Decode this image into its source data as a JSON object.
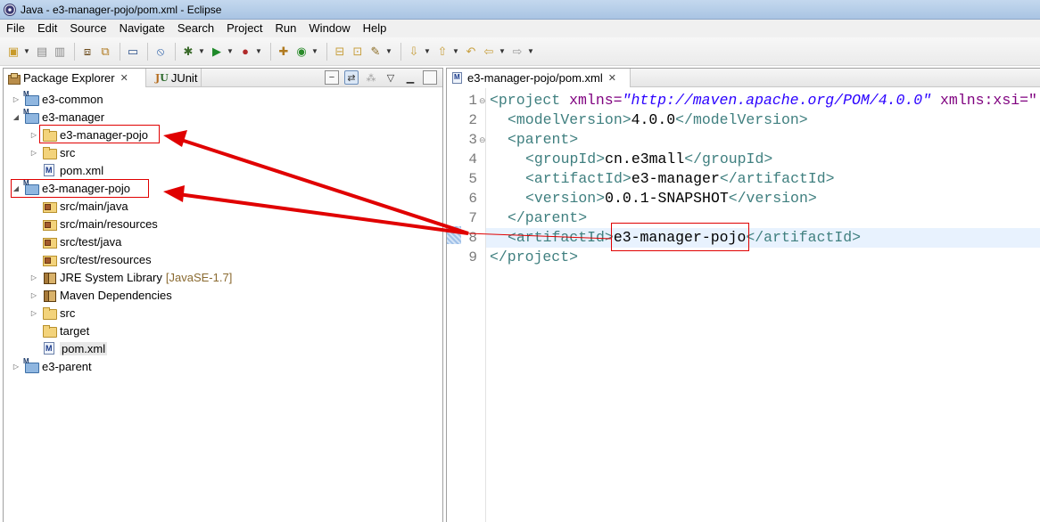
{
  "window": {
    "title": "Java - e3-manager-pojo/pom.xml - Eclipse"
  },
  "menu": [
    "File",
    "Edit",
    "Source",
    "Navigate",
    "Search",
    "Project",
    "Run",
    "Window",
    "Help"
  ],
  "left_panel": {
    "tabs": [
      {
        "label": "Package Explorer",
        "active": true
      },
      {
        "label": "JUnit",
        "active": false
      }
    ],
    "tree": [
      {
        "label": "e3-common",
        "icon": "maven-project-icon",
        "level": 0,
        "state": "collapsed"
      },
      {
        "label": "e3-manager",
        "icon": "maven-project-icon",
        "level": 0,
        "state": "expanded"
      },
      {
        "label": "e3-manager-pojo",
        "icon": "folder-icon",
        "level": 1,
        "state": "collapsed"
      },
      {
        "label": "src",
        "icon": "folder-icon",
        "level": 1,
        "state": "collapsed"
      },
      {
        "label": "pom.xml",
        "icon": "maven-xml-icon",
        "level": 1,
        "state": "leaf"
      },
      {
        "label": "e3-manager-pojo",
        "icon": "maven-project-icon",
        "level": 0,
        "state": "expanded"
      },
      {
        "label": "src/main/java",
        "icon": "source-folder-icon",
        "level": 1,
        "state": "leaf"
      },
      {
        "label": "src/main/resources",
        "icon": "source-folder-icon",
        "level": 1,
        "state": "leaf"
      },
      {
        "label": "src/test/java",
        "icon": "source-folder-icon",
        "level": 1,
        "state": "leaf"
      },
      {
        "label": "src/test/resources",
        "icon": "source-folder-icon",
        "level": 1,
        "state": "leaf"
      },
      {
        "label": "JRE System Library",
        "decoration": "[JavaSE-1.7]",
        "icon": "library-icon",
        "level": 1,
        "state": "collapsed"
      },
      {
        "label": "Maven Dependencies",
        "icon": "library-icon",
        "level": 1,
        "state": "collapsed"
      },
      {
        "label": "src",
        "icon": "folder-icon",
        "level": 1,
        "state": "collapsed"
      },
      {
        "label": "target",
        "icon": "folder-icon",
        "level": 1,
        "state": "leaf"
      },
      {
        "label": "pom.xml",
        "icon": "maven-xml-icon",
        "level": 1,
        "state": "leaf",
        "selected": true
      },
      {
        "label": "e3-parent",
        "icon": "maven-project-icon",
        "level": 0,
        "state": "collapsed"
      }
    ]
  },
  "editor": {
    "tab_label": "e3-manager-pojo/pom.xml",
    "current_line": 8,
    "lines": [
      {
        "n": "1",
        "fold": "⊖"
      },
      {
        "n": "2",
        "fold": ""
      },
      {
        "n": "3",
        "fold": "⊖"
      },
      {
        "n": "4",
        "fold": ""
      },
      {
        "n": "5",
        "fold": ""
      },
      {
        "n": "6",
        "fold": ""
      },
      {
        "n": "7",
        "fold": ""
      },
      {
        "n": "8",
        "fold": ""
      },
      {
        "n": "9",
        "fold": ""
      }
    ],
    "code": {
      "l1_open": "<project ",
      "l1_attr1": "xmlns=",
      "l1_val1": "\"http://maven.apache.org/POM/4.0.0\"",
      "l1_attr2": " xmlns:xsi=\"",
      "l2_open": "<modelVersion>",
      "l2_text": "4.0.0",
      "l2_close": "</modelVersion>",
      "l3_open": "<parent>",
      "l4_open": "<groupId>",
      "l4_text": "cn.e3mall",
      "l4_close": "</groupId>",
      "l5_open": "<artifactId>",
      "l5_text": "e3-manager",
      "l5_close": "</artifactId>",
      "l6_open": "<version>",
      "l6_text": "0.0.1-SNAPSHOT",
      "l6_close": "</version>",
      "l7_close": "</parent>",
      "l8_open": "<artifactId>",
      "l8_text": "e3-manager-pojo",
      "l8_close": "</artifactId>",
      "l9_close": "</project>"
    }
  },
  "colors": {
    "annotation": "#e00000",
    "xml_tag": "#3f7f7f",
    "xml_attr": "#7f007f",
    "xml_value": "#2a00ff"
  }
}
